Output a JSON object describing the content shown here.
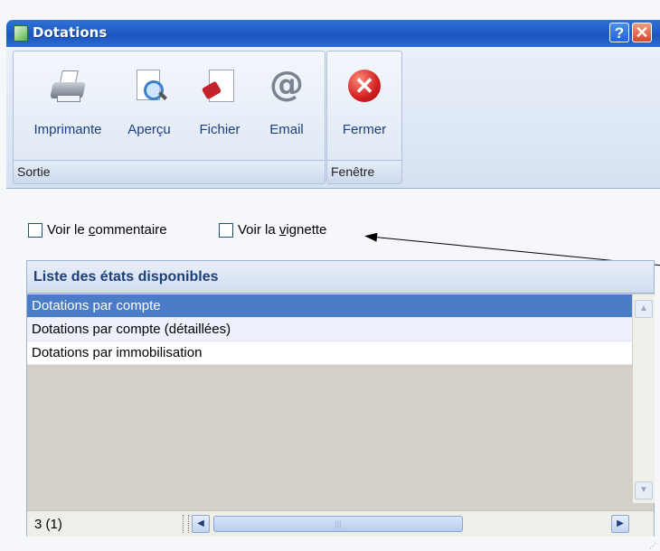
{
  "window": {
    "title": "Dotations",
    "help_label": "?",
    "close_label": "✕"
  },
  "ribbon": {
    "groups": [
      {
        "caption": "Sortie",
        "buttons": [
          {
            "label": "Imprimante",
            "icon": "printer-icon"
          },
          {
            "label": "Aperçu",
            "icon": "preview-icon"
          },
          {
            "label": "Fichier",
            "icon": "file-export-icon"
          },
          {
            "label": "Email",
            "icon": "email-at-icon"
          }
        ]
      },
      {
        "caption": "Fenêtre",
        "buttons": [
          {
            "label": "Fermer",
            "icon": "close-circle-icon"
          }
        ]
      }
    ]
  },
  "options": {
    "show_comment": {
      "pre": "Voir le ",
      "key": "c",
      "post": "ommentaire",
      "checked": false
    },
    "show_thumbnail": {
      "pre": "Voir la ",
      "key": "v",
      "post": "ignette",
      "checked": false
    }
  },
  "report_list": {
    "header": "Liste des états disponibles",
    "items": [
      {
        "label": "Dotations par compte",
        "selected": true
      },
      {
        "label": "Dotations par compte (détaillées)",
        "selected": false
      },
      {
        "label": "Dotations par immobilisation",
        "selected": false
      }
    ],
    "count": "3 (1)"
  },
  "colors": {
    "titlebar": "#1f5cc6",
    "selection": "#4a7cc8",
    "list_header_text": "#1c3f78",
    "close_button": "#d6482a"
  }
}
